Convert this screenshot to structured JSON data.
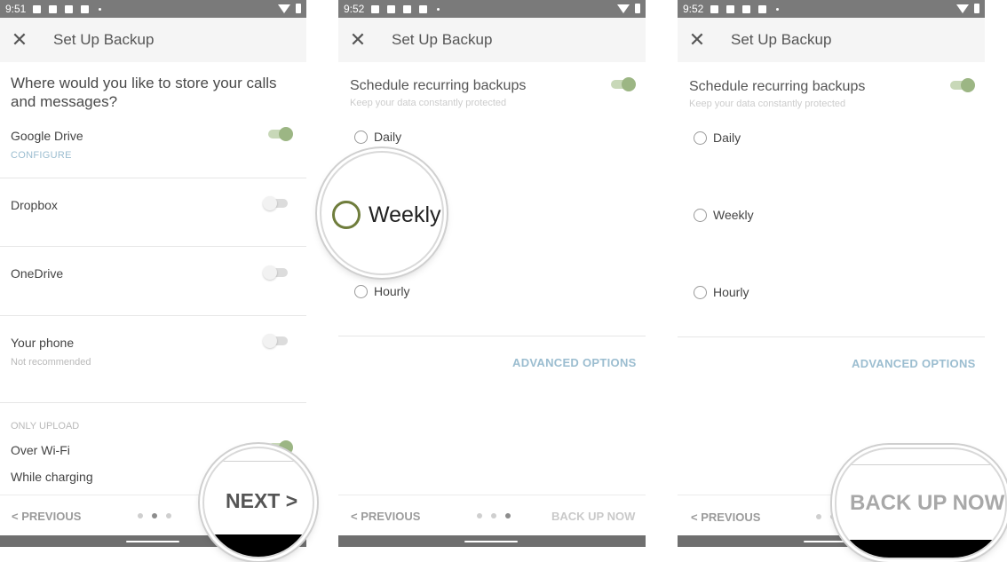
{
  "panel1": {
    "status_time": "9:51",
    "close_glyph": "✕",
    "title": "Set Up Backup",
    "question": "Where would you like to store your calls and messages?",
    "google_drive": {
      "label": "Google Drive",
      "sub": "CONFIGURE",
      "enabled": true
    },
    "dropbox": {
      "label": "Dropbox",
      "enabled": false
    },
    "onedrive": {
      "label": "OneDrive",
      "enabled": false
    },
    "your_phone": {
      "label": "Your phone",
      "sub": "Not recommended",
      "enabled": false
    },
    "only_upload": "ONLY UPLOAD",
    "over_wifi": {
      "label": "Over Wi-Fi",
      "enabled": true
    },
    "while_charging": "While charging",
    "previous": "< PREVIOUS",
    "next_zoom": "NEXT >",
    "pager_active_index": 1
  },
  "panel2": {
    "status_time": "9:52",
    "close_glyph": "✕",
    "title": "Set Up Backup",
    "schedule_label": "Schedule recurring backups",
    "schedule_sub": "Keep your data constantly protected",
    "schedule_enabled": true,
    "options": [
      "Daily",
      "Weekly",
      "Hourly"
    ],
    "weekly_zoom": "Weekly",
    "advanced": "ADVANCED OPTIONS",
    "previous": "< PREVIOUS",
    "next": "BACK UP NOW",
    "pager_active_index": 2
  },
  "panel3": {
    "status_time": "9:52",
    "close_glyph": "✕",
    "title": "Set Up Backup",
    "schedule_label": "Schedule recurring backups",
    "schedule_sub": "Keep your data constantly protected",
    "schedule_enabled": true,
    "options": [
      "Daily",
      "Weekly",
      "Hourly"
    ],
    "advanced": "ADVANCED OPTIONS",
    "previous": "< PREVIOUS",
    "backup_zoom": "BACK UP NOW",
    "pager_active_index": 2
  },
  "colors": {
    "toggle_on": "#9cb684",
    "toggle_on_track": "#c8d8b8",
    "link": "#9bbdd0",
    "status_bar": "#7a7a7a",
    "radio_focus": "#6f7d3c"
  },
  "icons": [
    "close-icon",
    "wifi-icon",
    "battery-icon",
    "notification-icon"
  ]
}
